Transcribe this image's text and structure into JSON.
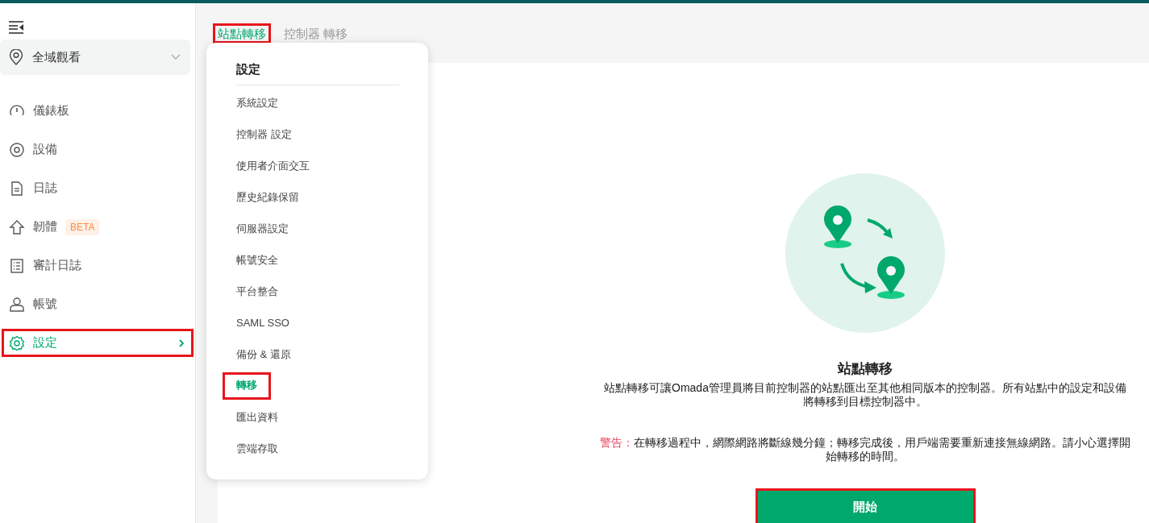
{
  "sidebar": {
    "site_selector": {
      "label": "全域觀看"
    },
    "nav_items": [
      {
        "kind": "dashboard",
        "label": "儀錶板",
        "selected": false,
        "highlighted": false
      },
      {
        "kind": "devices",
        "label": "設備",
        "selected": false,
        "highlighted": false
      },
      {
        "kind": "logs",
        "label": "日誌",
        "selected": false,
        "highlighted": false
      },
      {
        "kind": "firmware",
        "label": "韌體",
        "badge": "BETA",
        "selected": false,
        "highlighted": false
      },
      {
        "kind": "audit",
        "label": "審計日誌",
        "selected": false,
        "highlighted": false
      },
      {
        "kind": "account",
        "label": "帳號",
        "selected": false,
        "highlighted": false
      },
      {
        "kind": "settings",
        "label": "設定",
        "selected": true,
        "highlighted": true
      }
    ]
  },
  "tabs": [
    {
      "label": "站點轉移",
      "selected": true,
      "highlighted": true
    },
    {
      "label": "控制器 轉移",
      "selected": false,
      "highlighted": false
    }
  ],
  "settings_menu": {
    "title": "設定",
    "items": [
      {
        "label": "系統設定",
        "selected": false,
        "highlighted": false
      },
      {
        "label": "控制器 設定",
        "selected": false,
        "highlighted": false
      },
      {
        "label": "使用者介面交互",
        "selected": false,
        "highlighted": false
      },
      {
        "label": "歷史紀錄保留",
        "selected": false,
        "highlighted": false
      },
      {
        "label": "伺服器設定",
        "selected": false,
        "highlighted": false
      },
      {
        "label": "帳號安全",
        "selected": false,
        "highlighted": false
      },
      {
        "label": "平台整合",
        "selected": false,
        "highlighted": false
      },
      {
        "label": "SAML SSO",
        "selected": false,
        "highlighted": false
      },
      {
        "label": "備份 & 還原",
        "selected": false,
        "highlighted": false
      },
      {
        "label": "轉移",
        "selected": true,
        "highlighted": true
      },
      {
        "label": "匯出資料",
        "selected": false,
        "highlighted": false
      },
      {
        "label": "雲端存取",
        "selected": false,
        "highlighted": false
      }
    ]
  },
  "migration": {
    "title": "站點轉移",
    "description": "站點轉移可讓Omada管理員將目前控制器的站點匯出至其他相同版本的控制器。所有站點中的設定和設備將轉移到目標控制器中。",
    "warning_label": "警告：",
    "warning_text": "在轉移過程中，網際網路將斷線幾分鐘；轉移完成後，用戶端需要重新連接無線網路。請小心選擇開始轉移的時間。",
    "start_button": {
      "label": "開始",
      "highlighted": true
    }
  }
}
